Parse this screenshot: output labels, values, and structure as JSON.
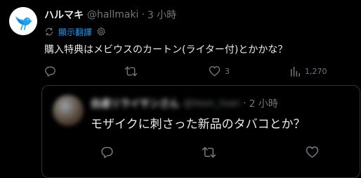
{
  "main_tweet": {
    "display_name": "ハルマキ",
    "handle": "@hallmaki",
    "separator": "·",
    "time": "3 小時",
    "translate_label": "顯示翻譯",
    "text": "購入特典はメビウスのカートン(ライター付)とかかな？",
    "actions": {
      "reply_count": "",
      "retweet_count": "",
      "like_count": "3",
      "views_count": "1,270"
    }
  },
  "reply_tweet": {
    "display_name": "自虐リライサンさん",
    "handle": "@lleon_lisan",
    "separator": "·",
    "time": "2 小時",
    "text": "モザイクに刺さった新品のタバコとか？"
  },
  "colors": {
    "background": "#000000",
    "text_primary": "#e7e9ea",
    "text_secondary": "#71767b",
    "accent": "#1d9bf0",
    "border": "#2f3336",
    "avatar_bird": "#1da1f2"
  },
  "icons": {
    "reply": "reply-icon",
    "retweet": "retweet-icon",
    "like": "heart-icon",
    "views": "views-bar-icon",
    "translate": "translate-icon",
    "settings": "gear-icon",
    "avatar": "bird-avatar"
  }
}
